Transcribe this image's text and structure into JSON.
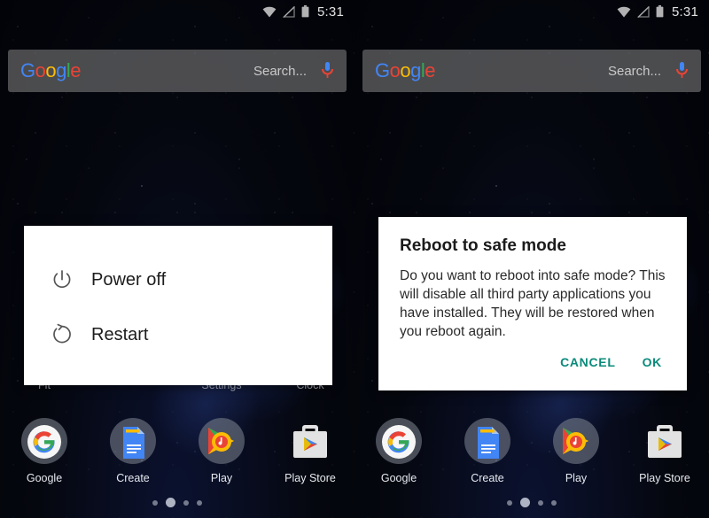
{
  "status_bar": {
    "time": "5:31",
    "icons": [
      "wifi-icon",
      "no-sim-signal-icon",
      "battery-icon"
    ]
  },
  "search_widget": {
    "logo_letters": [
      "G",
      "o",
      "o",
      "g",
      "l",
      "e"
    ],
    "placeholder": "Search...",
    "mic_icon": "microphone-icon"
  },
  "home_screen": {
    "app_labels": [
      "Fit",
      "",
      "Settings",
      "Clock"
    ],
    "dock": [
      {
        "label": "Google",
        "icon": "google-app-icon"
      },
      {
        "label": "Create",
        "icon": "google-docs-create-icon"
      },
      {
        "label": "Play",
        "icon": "google-play-music-icon"
      },
      {
        "label": "Play Store",
        "icon": "google-play-store-icon"
      }
    ],
    "page_dots": {
      "count": 4,
      "active_index": 1
    }
  },
  "left_panel": {
    "power_menu": {
      "items": [
        {
          "label": "Power off",
          "icon": "power-icon"
        },
        {
          "label": "Restart",
          "icon": "restart-icon"
        }
      ]
    }
  },
  "right_panel": {
    "safe_mode_dialog": {
      "title": "Reboot to safe mode",
      "body": "Do you want to reboot into safe mode? This will disable all third party applications you have installed. They will be restored when you reboot again.",
      "cancel_label": "CANCEL",
      "ok_label": "OK",
      "accent_color": "#0a8a7a"
    }
  }
}
